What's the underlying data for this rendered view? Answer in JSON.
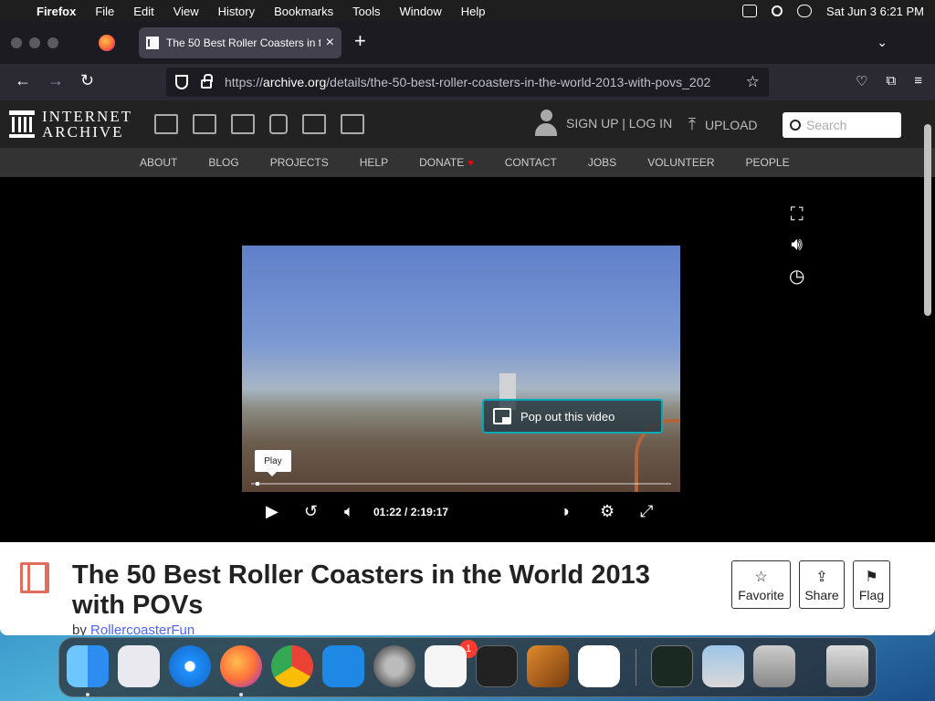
{
  "menubar": {
    "app": "Firefox",
    "items": [
      "File",
      "Edit",
      "View",
      "History",
      "Bookmarks",
      "Tools",
      "Window",
      "Help"
    ],
    "datetime": "Sat Jun 3  6:21 PM"
  },
  "browser": {
    "tab_title": "The 50 Best Roller Coasters in t",
    "url_prefix": "https://",
    "url_host": "archive.org",
    "url_path": "/details/the-50-best-roller-coasters-in-the-world-2013-with-povs_202"
  },
  "ia": {
    "logo_line1": "INTERNET",
    "logo_line2": "ARCHIVE",
    "signup": "SIGN UP | LOG IN",
    "upload": "UPLOAD",
    "search_placeholder": "Search",
    "nav": [
      "ABOUT",
      "BLOG",
      "PROJECTS",
      "HELP",
      "DONATE",
      "CONTACT",
      "JOBS",
      "VOLUNTEER",
      "PEOPLE"
    ]
  },
  "player": {
    "popout_label": "Pop out this video",
    "play_tooltip": "Play",
    "current_time": "01:22",
    "separator": "/",
    "duration": "2:19:17",
    "progress_fraction": 0.0098
  },
  "item": {
    "title": "The 50 Best Roller Coasters in the World 2013 with POVs",
    "by_label": "by",
    "author": "RollercoasterFun",
    "actions": {
      "favorite": "Favorite",
      "share": "Share",
      "flag": "Flag"
    }
  },
  "dock": {
    "settings_badge": "1"
  },
  "colors": {
    "ia_dark": "#222222",
    "ia_nav": "#333333",
    "popout_border": "#00a9b7",
    "link": "#4b64ff",
    "film_icon": "#e06d5e"
  }
}
